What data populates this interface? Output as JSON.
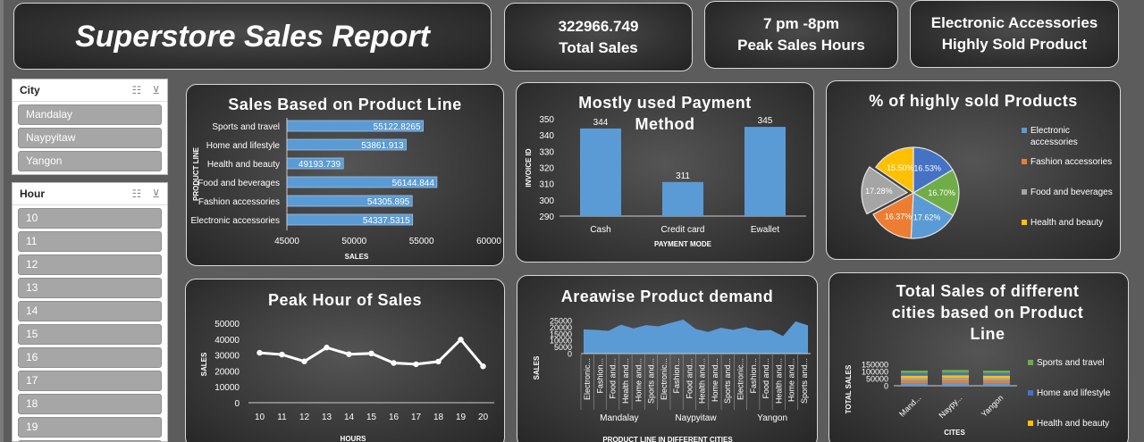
{
  "header": {
    "title": "Superstore Sales Report",
    "kpis": [
      {
        "value": "322966.749",
        "label": "Total Sales"
      },
      {
        "value": "7 pm -8pm",
        "label": "Peak Sales Hours"
      },
      {
        "value": "Electronic Accessories",
        "label": "Highly Sold Product"
      }
    ]
  },
  "slicers": {
    "city": {
      "title": "City",
      "items": [
        "Mandalay",
        "Naypyitaw",
        "Yangon"
      ]
    },
    "hour": {
      "title": "Hour",
      "items": [
        "10",
        "11",
        "12",
        "13",
        "14",
        "15",
        "16",
        "17",
        "18",
        "19"
      ]
    }
  },
  "charts": {
    "product_line": {
      "title": "Sales Based on Product Line"
    },
    "payment": {
      "title": "Mostly used Payment Method"
    },
    "pie": {
      "title": "% of highly sold Products"
    },
    "peak": {
      "title": "Peak Hour of Sales"
    },
    "area": {
      "title": "Areawise Product demand"
    },
    "cities": {
      "title": "Total Sales of different cities based on Product Line"
    }
  },
  "colors": {
    "bar_blue": "#5b9bd5",
    "orange": "#ed7d31",
    "gray": "#a5a5a5",
    "yellow": "#ffc000",
    "green": "#70ad47"
  },
  "chart_data": [
    {
      "type": "bar",
      "orientation": "horizontal",
      "title": "Sales Based on Product Line",
      "categories": [
        "Sports and travel",
        "Home and lifestyle",
        "Health and beauty",
        "Food and beverages",
        "Fashion accessories",
        "Electronic accessories"
      ],
      "values": [
        55122.8265,
        53861.913,
        49193.739,
        56144.844,
        54305.895,
        54337.5315
      ],
      "data_labels": [
        "55122.8265",
        "53861.913",
        "49193.739",
        "56144.844",
        "54305.895",
        "54337.5315"
      ],
      "xlabel": "SALES",
      "ylabel": "PRODUCT LINE",
      "xlim": [
        45000,
        60000
      ],
      "ticks": [
        "45000",
        "50000",
        "55000",
        "60000"
      ]
    },
    {
      "type": "bar",
      "title": "Mostly used Payment Method",
      "categories": [
        "Cash",
        "Credit card",
        "Ewallet"
      ],
      "values": [
        344,
        311,
        345
      ],
      "xlabel": "PAYMENT MODE",
      "ylabel": "INVOICE ID",
      "ylim": [
        290,
        350
      ],
      "ticks": [
        "290",
        "300",
        "310",
        "320",
        "330",
        "340",
        "350"
      ]
    },
    {
      "type": "pie",
      "title": "% of highly sold Products",
      "visible_legend": [
        "Electronic accessories",
        "Fashion accessories",
        "Food and beverages",
        "Health and beauty"
      ],
      "slices": [
        {
          "label": "16.53%",
          "value": 16.53,
          "color": "#4472c4"
        },
        {
          "label": "16.70%",
          "value": 16.7,
          "color": "#70ad47"
        },
        {
          "label": "17.62%",
          "value": 17.62,
          "color": "#5b9bd5"
        },
        {
          "label": "16.37%",
          "value": 16.37,
          "color": "#ed7d31"
        },
        {
          "label": "17.28%",
          "value": 17.28,
          "color": "#a5a5a5"
        },
        {
          "label": "15.50%",
          "value": 15.5,
          "color": "#ffc000"
        }
      ]
    },
    {
      "type": "line",
      "title": "Peak Hour of Sales",
      "x": [
        "10",
        "11",
        "12",
        "13",
        "14",
        "15",
        "16",
        "17",
        "18",
        "19",
        "20"
      ],
      "values": [
        31400,
        30300,
        26000,
        34700,
        30500,
        31000,
        25000,
        24200,
        25900,
        39700,
        22900
      ],
      "xlabel": "HOURS",
      "ylabel": "SALES",
      "ylim": [
        0,
        50000
      ],
      "ticks": [
        "0",
        "10000",
        "20000",
        "30000",
        "40000",
        "50000"
      ]
    },
    {
      "type": "area",
      "title": "Areawise Product demand",
      "groups": [
        "Mandalay",
        "Naypyitaw",
        "Yangon"
      ],
      "categories": [
        "Electronic...",
        "Fashion...",
        "Food and...",
        "Health and...",
        "Home and...",
        "Sports and..."
      ],
      "values": [
        18300,
        17900,
        17200,
        21900,
        19000,
        21500,
        20600,
        23200,
        25700,
        18600,
        16400,
        19500,
        18000,
        20000,
        17500,
        17900,
        13300,
        24400,
        21400
      ],
      "xlabel": "PRODUCT LINE IN DIFFERENT CITIES",
      "ylabel": "SALES",
      "ylim": [
        0,
        25000
      ],
      "ticks": [
        "0",
        "5000",
        "10000",
        "15000",
        "20000",
        "25000"
      ]
    },
    {
      "type": "bar",
      "stacked": true,
      "title": "Total Sales of different cities based on Product Line",
      "categories": [
        "Mand...",
        "Naypy...",
        "Yangon"
      ],
      "visible_legend": [
        "Sports and travel",
        "Home and lifestyle",
        "Health and beauty"
      ],
      "values": [
        106200,
        110600,
        106200
      ],
      "xlabel": "CITES",
      "ylabel": "TOTAL SALES",
      "ylim": [
        0,
        150000
      ],
      "ticks": [
        "0",
        "50000",
        "100000",
        "150000"
      ]
    }
  ]
}
